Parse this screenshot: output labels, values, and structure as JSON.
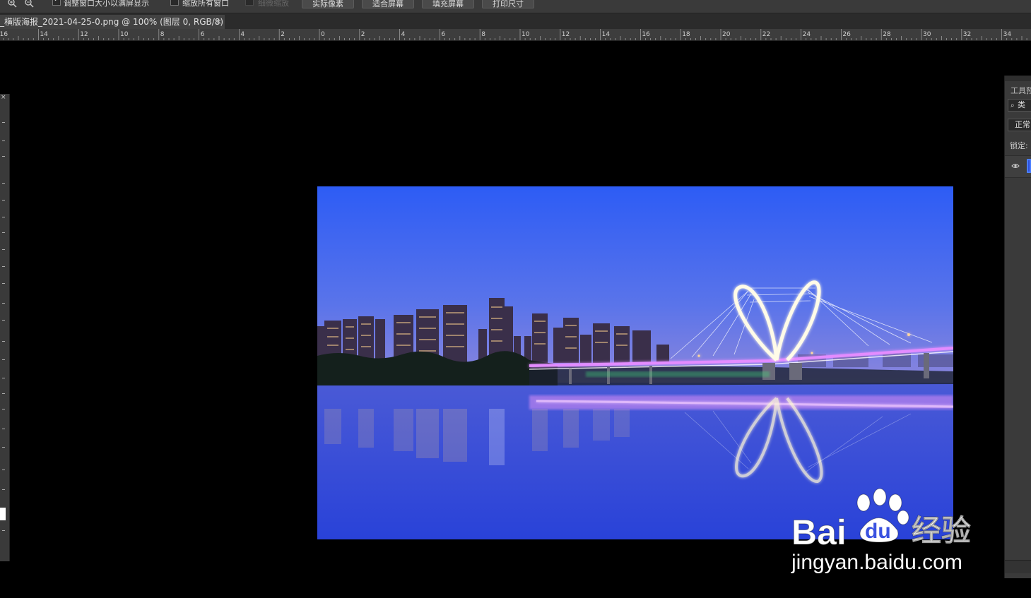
{
  "options_bar": {
    "checkbox_resize": {
      "label": "调整窗口大小以满屏显示",
      "checked": true
    },
    "checkbox_zoom_all": {
      "label": "缩放所有窗口",
      "checked": false
    },
    "checkbox_scrubby": {
      "label": "细微缩放",
      "checked": false,
      "disabled": true
    },
    "buttons": [
      "实际像素",
      "适合屏幕",
      "填充屏幕",
      "打印尺寸"
    ],
    "icons": [
      "zoom-in-icon",
      "zoom-out-icon"
    ]
  },
  "document_tab": {
    "title": "_横版海报_2021-04-25-0.png @ 100% (图层 0, RGB/8)",
    "close": "×"
  },
  "ruler": {
    "labels": [
      "16",
      "14",
      "12",
      "10",
      "8",
      "6",
      "4",
      "2",
      "0",
      "2",
      "4",
      "6",
      "8",
      "10",
      "12",
      "14",
      "16",
      "18",
      "20",
      "22",
      "24",
      "26",
      "28",
      "30",
      "32",
      "34"
    ]
  },
  "toolbar": {
    "close": "×"
  },
  "layers_panel": {
    "title": "工具预设",
    "search_kind": "类",
    "blend_mode": "正常",
    "lock_label": "锁定:",
    "visibility_icon": "eye-icon",
    "layer_thumbnail_color": "#2e4fd8"
  },
  "canvas": {
    "image_description_colors": {
      "sky_top": "#2c5af2",
      "sky_bottom": "#6a78e6",
      "water": "#3046d8"
    }
  },
  "watermark": {
    "logo_text": "Bai",
    "logo_text_cn": "经验",
    "url": "jingyan.baidu.com"
  }
}
